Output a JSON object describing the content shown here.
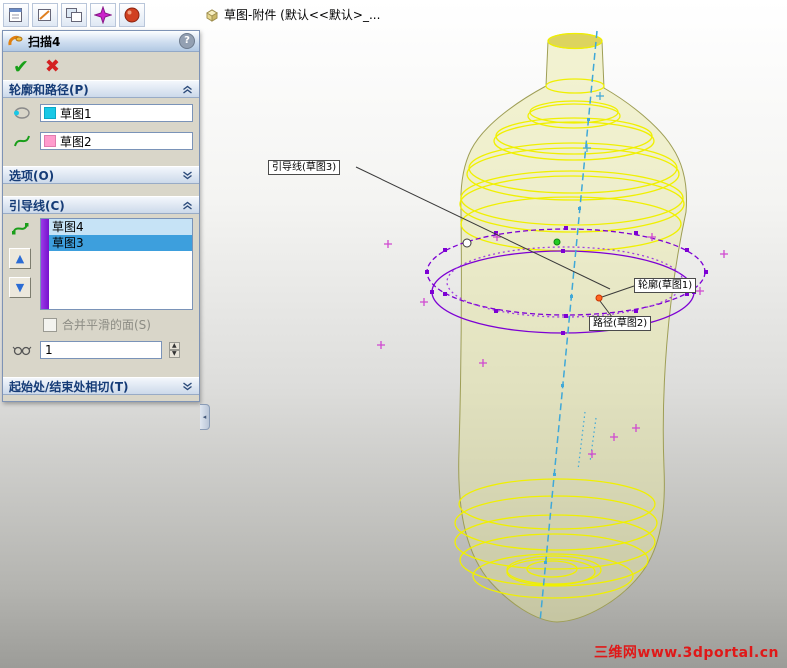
{
  "icons": {
    "ok": "✔",
    "cancel": "✖",
    "help": "?",
    "arrow_up": "▲",
    "arrow_down": "▼"
  },
  "toolbar": {
    "buttons": [
      {
        "name": "document-icon"
      },
      {
        "name": "sketch-icon"
      },
      {
        "name": "drawing-grid-icon"
      },
      {
        "name": "axis-star-icon"
      },
      {
        "name": "render-sphere-icon"
      }
    ]
  },
  "document_label": {
    "text": "草图-附件 (默认<<默认>_..."
  },
  "property_panel": {
    "title": "扫描4",
    "sections": {
      "profile_path": {
        "label": "轮廓和路径(P)",
        "profile_value": "草图1",
        "path_value": "草图2"
      },
      "options": {
        "label": "选项(O)"
      },
      "guides": {
        "label": "引导线(C)",
        "items": [
          {
            "label": "草图4"
          },
          {
            "label": "草图3"
          }
        ],
        "merge_label": "合并平滑的面(S)",
        "spinner_value": "1"
      },
      "tangency": {
        "label": "起始处/结束处相切(T)"
      }
    }
  },
  "viewport": {
    "callouts": {
      "guide": "引导线(草图3)",
      "profile": "轮廓(草图1)",
      "path": "路径(草图2)"
    },
    "watermark": "三维网www.3dportal.cn",
    "colors": {
      "wireframe_yellow": "#f0f000",
      "guide_purple": "#7d00d4",
      "centerline_blue": "#3fa8d8",
      "selection_blue": "#3d9fdd",
      "profile_swatch": "#19c8e6",
      "path_swatch": "#ff9ccd"
    }
  }
}
